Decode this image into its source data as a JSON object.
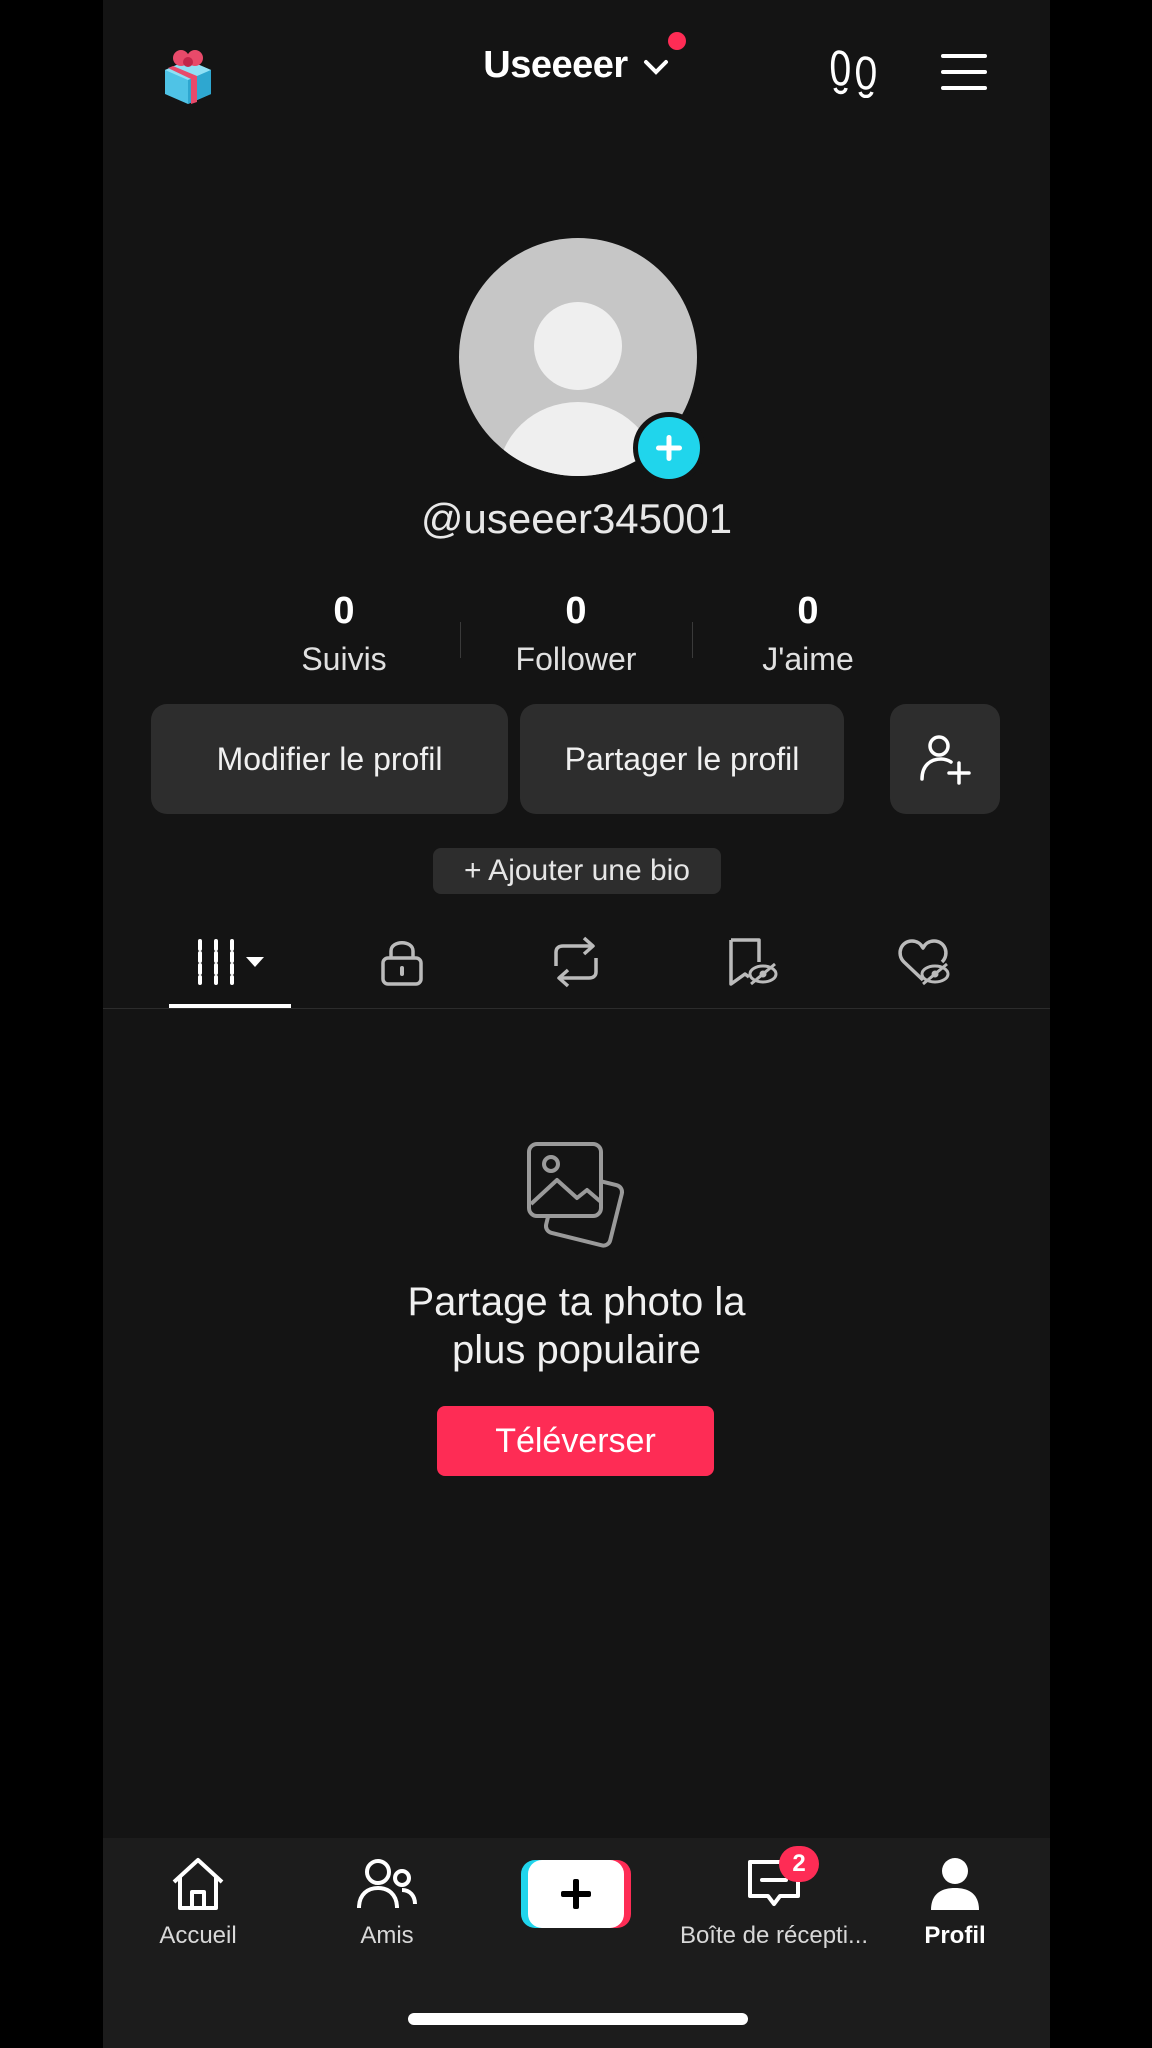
{
  "header": {
    "account_name": "Useeeer",
    "icons": [
      "gift-icon",
      "chevron-down-icon",
      "footprints-icon",
      "menu-icon"
    ]
  },
  "profile": {
    "handle": "@useeer345001",
    "stats": [
      {
        "value": "0",
        "label": "Suivis"
      },
      {
        "value": "0",
        "label": "Follower"
      },
      {
        "value": "0",
        "label": "J'aime"
      }
    ],
    "edit_label": "Modifier le profil",
    "share_label": "Partager le profil",
    "add_bio_label": "+ Ajouter une bio"
  },
  "tabs": [
    "videos-grid-icon",
    "lock-icon",
    "repost-icon",
    "hidden-favorites-icon",
    "hidden-likes-icon"
  ],
  "empty_state": {
    "title_line1": "Partage ta photo la",
    "title_line2": "plus populaire",
    "upload_label": "Téléverser"
  },
  "bottom_nav": {
    "home": "Accueil",
    "friends": "Amis",
    "inbox": "Boîte de récepti...",
    "inbox_badge": "2",
    "profile": "Profil"
  },
  "colors": {
    "background": "#141414",
    "accent": "#fe2c55",
    "cyan": "#20d5ec",
    "button_bg": "#2d2d2d"
  }
}
